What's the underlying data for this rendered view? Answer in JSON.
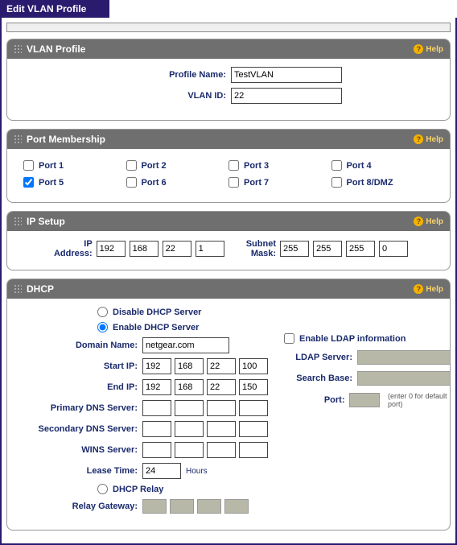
{
  "page": {
    "title": "Edit VLAN Profile"
  },
  "help_label": "Help",
  "sections": {
    "vlan_profile": {
      "title": "VLAN Profile",
      "profile_name_label": "Profile Name:",
      "profile_name_value": "TestVLAN",
      "vlan_id_label": "VLAN ID:",
      "vlan_id_value": "22"
    },
    "port_membership": {
      "title": "Port Membership",
      "ports": [
        {
          "label": "Port 1",
          "checked": false
        },
        {
          "label": "Port 2",
          "checked": false
        },
        {
          "label": "Port 3",
          "checked": false
        },
        {
          "label": "Port 4",
          "checked": false
        },
        {
          "label": "Port 5",
          "checked": true
        },
        {
          "label": "Port 6",
          "checked": false
        },
        {
          "label": "Port 7",
          "checked": false
        },
        {
          "label": "Port 8/DMZ",
          "checked": false
        }
      ]
    },
    "ip_setup": {
      "title": "IP Setup",
      "ip_label": "IP Address:",
      "ip": [
        "192",
        "168",
        "22",
        "1"
      ],
      "mask_label": "Subnet Mask:",
      "mask": [
        "255",
        "255",
        "255",
        "0"
      ]
    },
    "dhcp": {
      "title": "DHCP",
      "disable_label": "Disable DHCP Server",
      "enable_label": "Enable DHCP Server",
      "relay_label": "DHCP Relay",
      "mode": "enable",
      "domain_label": "Domain Name:",
      "domain_value": "netgear.com",
      "start_ip_label": "Start IP:",
      "start_ip": [
        "192",
        "168",
        "22",
        "100"
      ],
      "end_ip_label": "End IP:",
      "end_ip": [
        "192",
        "168",
        "22",
        "150"
      ],
      "primary_dns_label": "Primary DNS Server:",
      "primary_dns": [
        "",
        "",
        "",
        ""
      ],
      "secondary_dns_label": "Secondary DNS Server:",
      "secondary_dns": [
        "",
        "",
        "",
        ""
      ],
      "wins_label": "WINS Server:",
      "wins": [
        "",
        "",
        "",
        ""
      ],
      "lease_label": "Lease Time:",
      "lease_value": "24",
      "lease_units": "Hours",
      "relay_gateway_label": "Relay Gateway:",
      "ldap_checkbox_label": "Enable LDAP information",
      "ldap_server_label": "LDAP Server:",
      "search_base_label": "Search Base:",
      "port_label": "Port:",
      "port_hint": "(enter 0 for default port)"
    }
  }
}
